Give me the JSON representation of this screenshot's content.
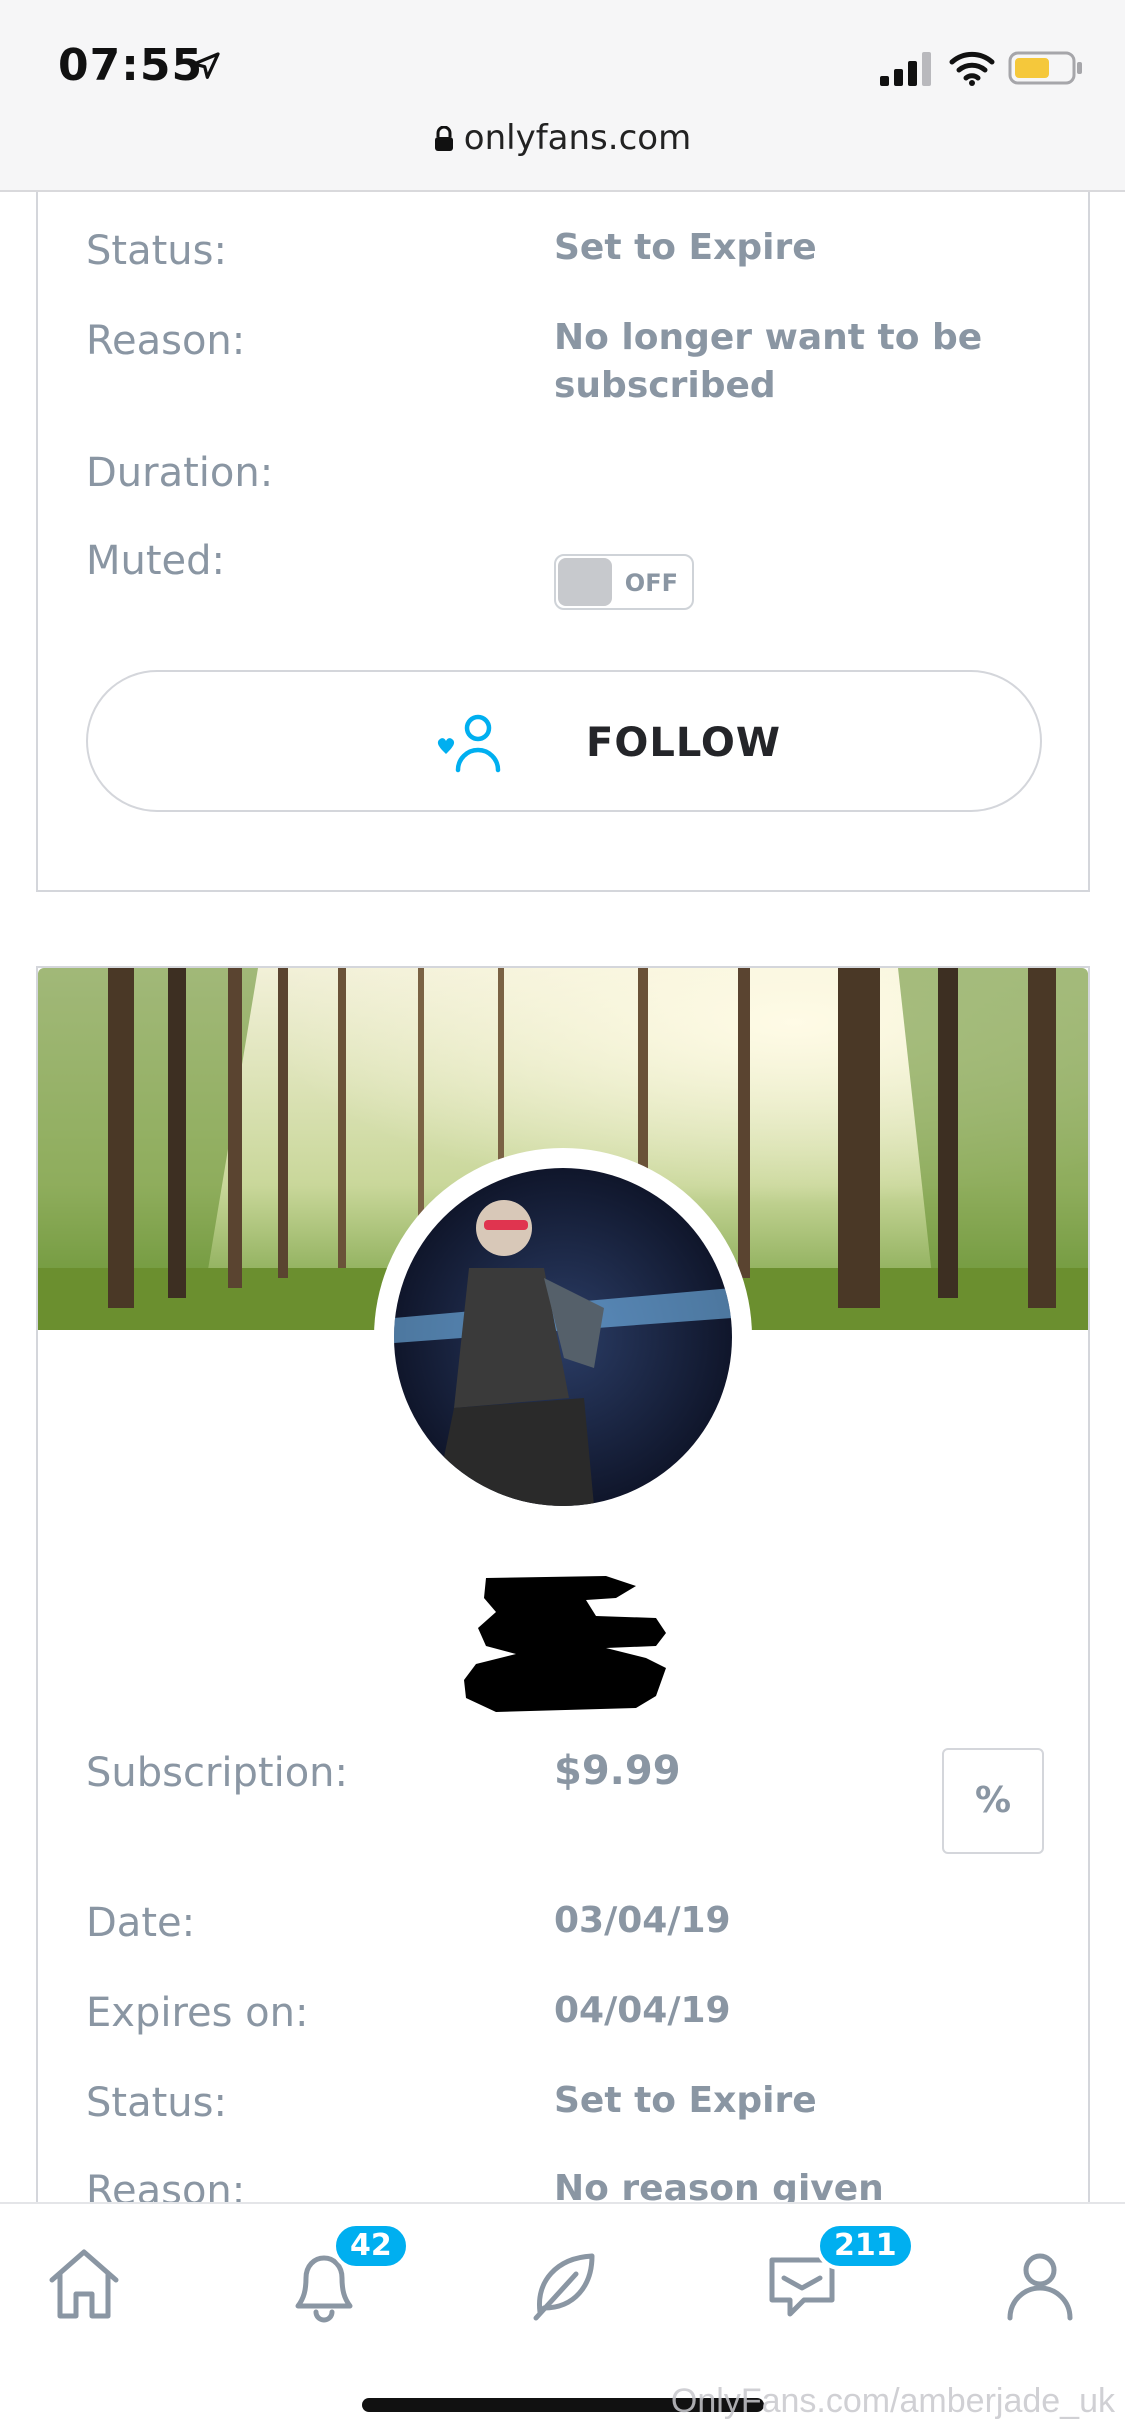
{
  "status_bar": {
    "time": "07:55",
    "url": "onlyfans.com"
  },
  "card1": {
    "rows": [
      {
        "label": "Status:",
        "value": "Set to Expire"
      },
      {
        "label": "Reason:",
        "value": "No longer want to be subscribed"
      },
      {
        "label": "Duration:",
        "value": ""
      },
      {
        "label": "Muted:",
        "value": ""
      }
    ],
    "muted_toggle": {
      "state_label": "OFF"
    },
    "follow_button": {
      "label": "FOLLOW"
    }
  },
  "card2": {
    "subscription": {
      "label": "Subscription:",
      "value": "$9.99"
    },
    "discount_button": {
      "label": "%"
    },
    "rows": [
      {
        "label": "Date:",
        "value": "03/04/19"
      },
      {
        "label": "Expires on:",
        "value": "04/04/19"
      },
      {
        "label": "Status:",
        "value": "Set to Expire"
      },
      {
        "label": "Reason:",
        "value": "No reason given"
      }
    ]
  },
  "bottom_nav": {
    "items": [
      {
        "icon": "home-icon"
      },
      {
        "icon": "bell-icon",
        "badge": "42"
      },
      {
        "icon": "feather-icon"
      },
      {
        "icon": "message-icon",
        "badge": "211"
      },
      {
        "icon": "profile-icon"
      }
    ]
  },
  "watermark": "OnlyFans.com/amberjade_uk",
  "colors": {
    "accent": "#00aff0",
    "muted_text": "#8a96a3",
    "border": "#d4d6db"
  }
}
